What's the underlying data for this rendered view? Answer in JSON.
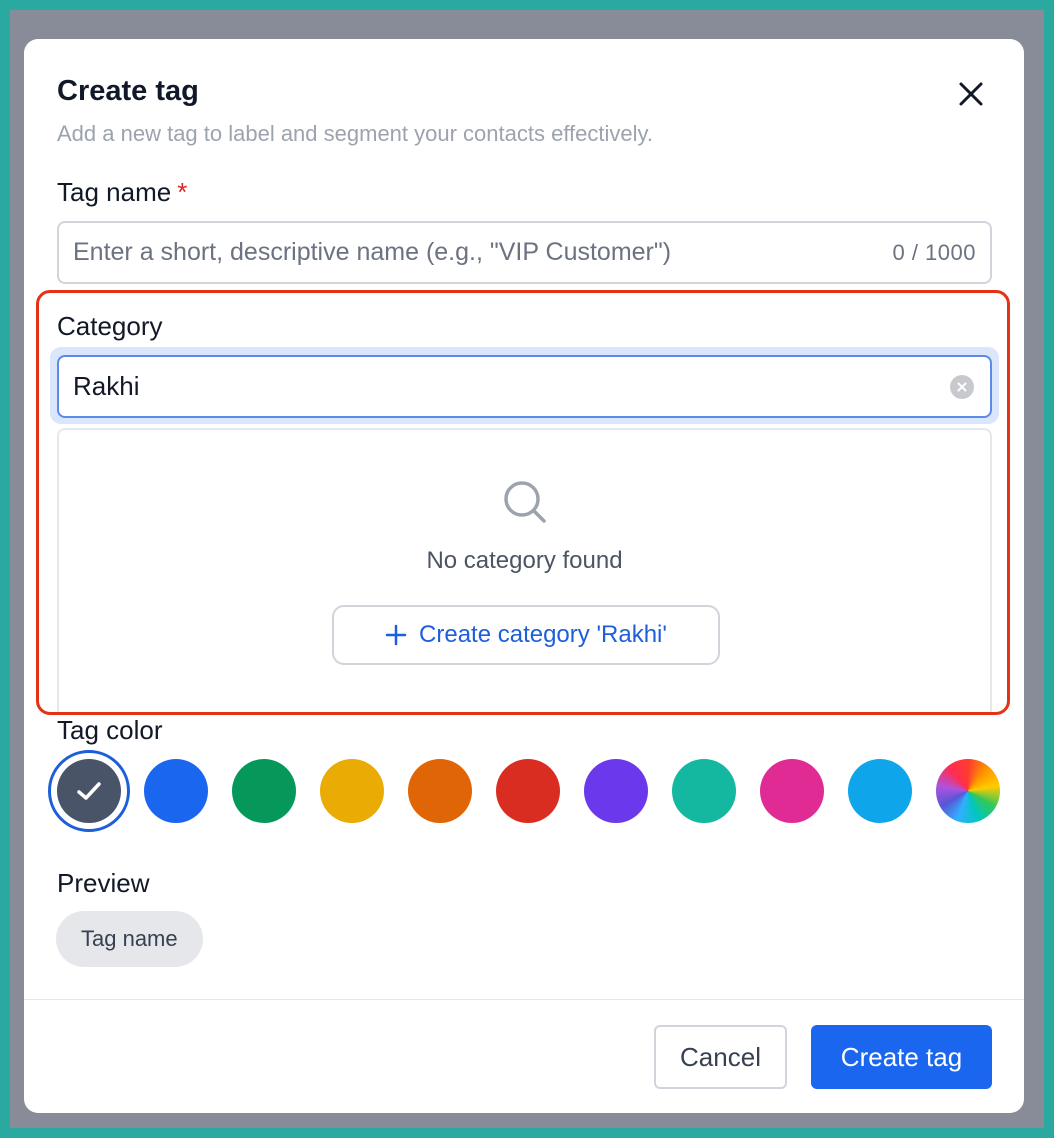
{
  "dialog": {
    "title": "Create tag",
    "subtitle": "Add a new tag to label and segment your contacts effectively.",
    "close_icon": "close-icon"
  },
  "tag_name": {
    "label": "Tag name",
    "required_marker": "*",
    "placeholder": "Enter a short, descriptive name (e.g., \"VIP Customer\")",
    "value": "",
    "counter": "0 / 1000"
  },
  "category": {
    "label": "Category",
    "value": "Rakhi",
    "clear_icon": "clear-circle-icon",
    "dropdown": {
      "empty_icon": "search-icon",
      "empty_text": "No category found",
      "create_label": "Create category 'Rakhi'",
      "create_icon": "plus-icon"
    }
  },
  "tag_color": {
    "label": "Tag color",
    "selected": "#4a5468",
    "swatches": [
      "#4a5468",
      "#1a66ee",
      "#06975a",
      "#eaab05",
      "#df6506",
      "#da2d22",
      "#6c38ec",
      "#14b7a0",
      "#e02b95",
      "#0ea5ea",
      "rainbow"
    ]
  },
  "preview": {
    "label": "Preview",
    "pill_text": "Tag name"
  },
  "footer": {
    "cancel_label": "Cancel",
    "create_label": "Create tag"
  },
  "colors": {
    "primary": "#1a66ee",
    "highlight": "#e53217",
    "required": "#dc2626"
  }
}
